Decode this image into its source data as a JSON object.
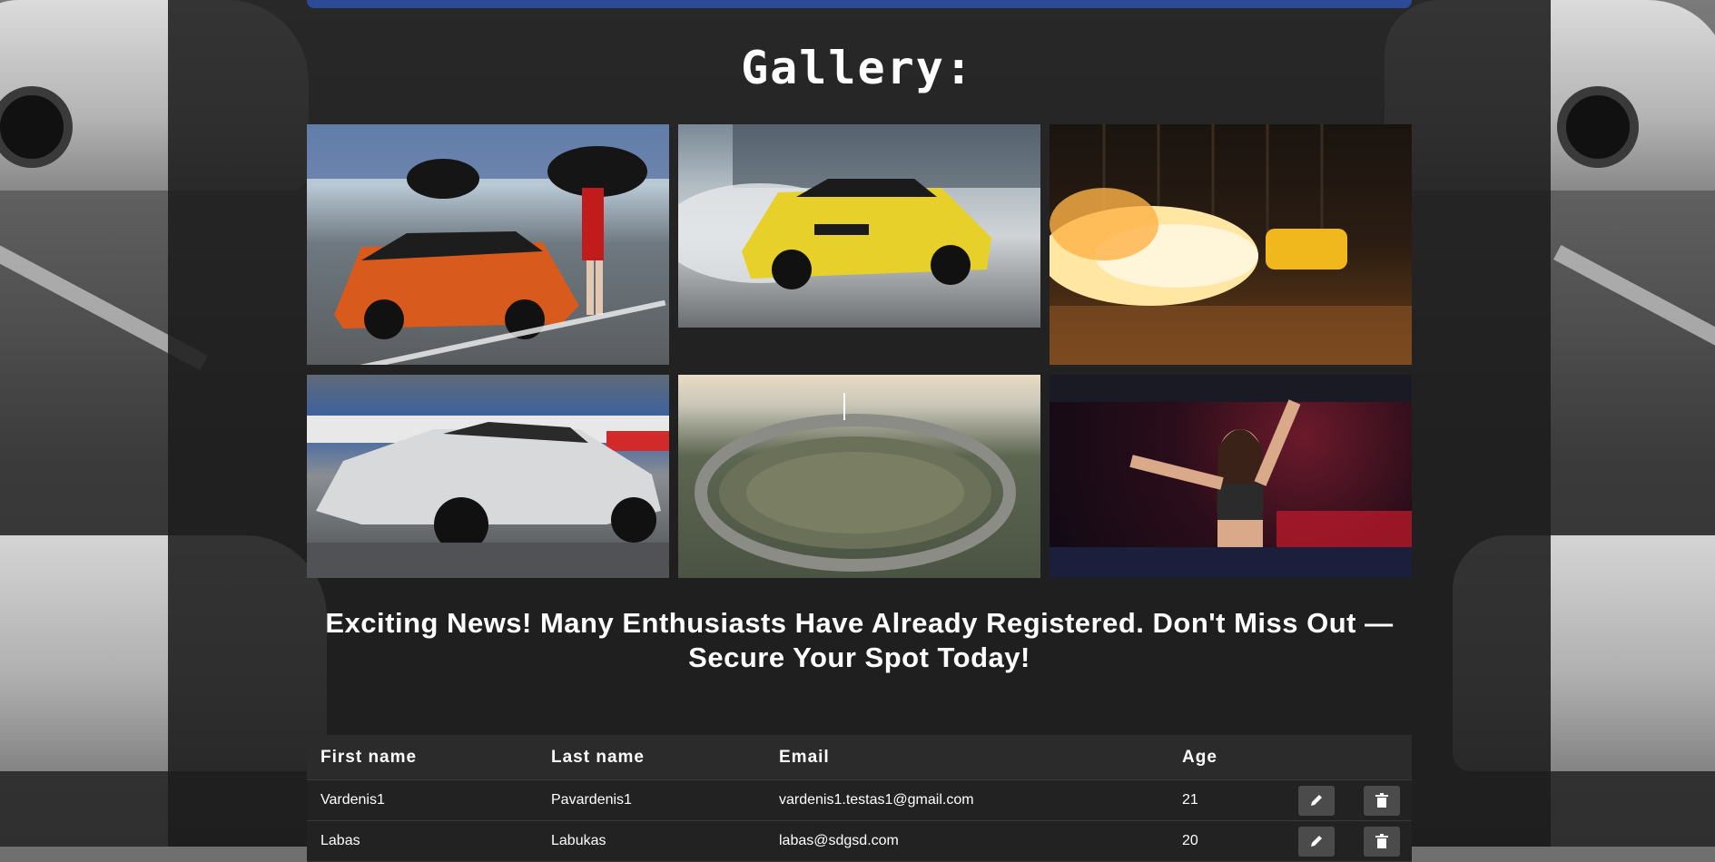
{
  "gallery": {
    "title": "Gallery:",
    "photos": [
      {
        "subject": "drift car with umbrella girls on track"
      },
      {
        "subject": "yellow drift car smoking tires"
      },
      {
        "subject": "jet truck with flames at night"
      },
      {
        "subject": "white GT-R drag car"
      },
      {
        "subject": "aerial view of race track"
      },
      {
        "subject": "DJ performing at event"
      }
    ]
  },
  "news": {
    "text": "Exciting News! Many Enthusiasts Have Already Registered. Don't Miss Out —Secure Your Spot Today!"
  },
  "table": {
    "headers": [
      "First name",
      "Last name",
      "Email",
      "Age"
    ],
    "rows": [
      {
        "first": "Vardenis1",
        "last": "Pavardenis1",
        "email": "vardenis1.testas1@gmail.com",
        "age": "21"
      },
      {
        "first": "Labas",
        "last": "Labukas",
        "email": "labas@sdgsd.com",
        "age": "20"
      }
    ]
  },
  "icons": {
    "edit": "pencil-icon",
    "delete": "trash-icon"
  },
  "colors": {
    "accent": "#2c4a96",
    "panel": "#1c1c1c",
    "button": "#4b4b4b"
  }
}
